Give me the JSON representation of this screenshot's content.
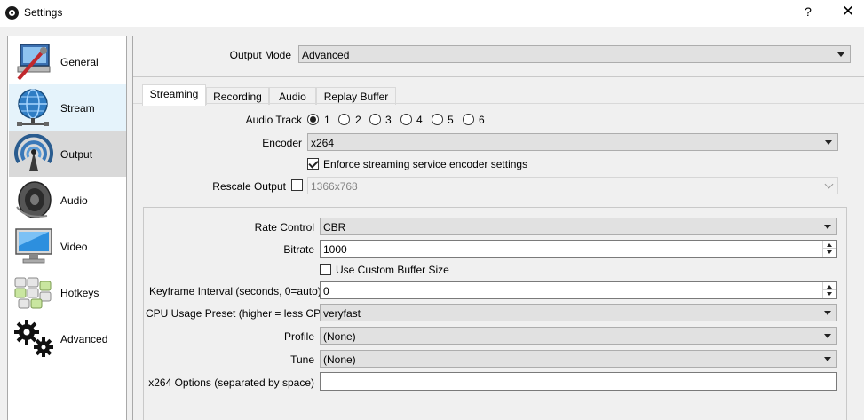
{
  "window": {
    "title": "Settings",
    "help_glyph": "?",
    "close_glyph": "✕"
  },
  "sidebar": {
    "items": [
      {
        "label": "General",
        "icon": "general-icon"
      },
      {
        "label": "Stream",
        "icon": "stream-globe-icon"
      },
      {
        "label": "Output",
        "icon": "output-antenna-icon"
      },
      {
        "label": "Audio",
        "icon": "speaker-icon"
      },
      {
        "label": "Video",
        "icon": "monitor-icon"
      },
      {
        "label": "Hotkeys",
        "icon": "keyboard-icon"
      },
      {
        "label": "Advanced",
        "icon": "gears-icon"
      }
    ],
    "selected": "Output",
    "hovered": "Stream"
  },
  "output_mode": {
    "label": "Output Mode",
    "value": "Advanced"
  },
  "tabs": [
    {
      "label": "Streaming",
      "active": true
    },
    {
      "label": "Recording",
      "active": false
    },
    {
      "label": "Audio",
      "active": false
    },
    {
      "label": "Replay Buffer",
      "active": false
    }
  ],
  "streaming": {
    "audio_track": {
      "label": "Audio Track",
      "options": [
        "1",
        "2",
        "3",
        "4",
        "5",
        "6"
      ],
      "selected": "1"
    },
    "encoder": {
      "label": "Encoder",
      "value": "x264"
    },
    "enforce": {
      "label": "Enforce streaming service encoder settings",
      "checked": true
    },
    "rescale": {
      "label": "Rescale Output",
      "checked": false,
      "value": "1366x768"
    },
    "rate_control": {
      "label": "Rate Control",
      "value": "CBR"
    },
    "bitrate": {
      "label": "Bitrate",
      "value": "1000"
    },
    "custom_buffer": {
      "label": "Use Custom Buffer Size",
      "checked": false
    },
    "keyframe": {
      "label": "Keyframe Interval (seconds, 0=auto)",
      "value": "0"
    },
    "cpu_preset": {
      "label": "CPU Usage Preset (higher = less CPU)",
      "value": "veryfast"
    },
    "profile": {
      "label": "Profile",
      "value": "(None)"
    },
    "tune": {
      "label": "Tune",
      "value": "(None)"
    },
    "x264_options": {
      "label": "x264 Options (separated by space)",
      "value": ""
    }
  },
  "colors": {
    "selected_bg": "#d9d9d9",
    "hover_bg": "#e5f3fb",
    "window_bg": "#f0f0f0"
  }
}
